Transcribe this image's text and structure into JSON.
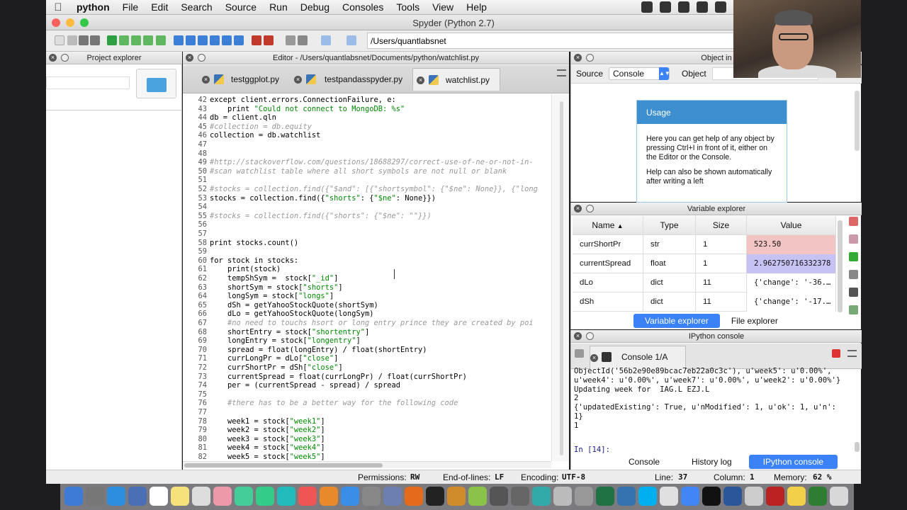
{
  "menubar": {
    "apple_icon": "apple-icon",
    "app": "python",
    "items": [
      "File",
      "Edit",
      "Search",
      "Source",
      "Run",
      "Debug",
      "Consoles",
      "Tools",
      "View",
      "Help"
    ]
  },
  "window": {
    "title": "Spyder (Python 2.7)"
  },
  "toolbar": {
    "path": "/Users/quantlabsnet"
  },
  "project_explorer": {
    "title": "Project explorer"
  },
  "editor": {
    "title": "Editor - /Users/quantlabsnet/Documents/python/watchlist.py",
    "tabs": [
      "testggplot.py",
      "testpandasspyder.py",
      "watchlist.py"
    ],
    "active_tab": 2,
    "lines": [
      {
        "n": "42",
        "t": "except client.errors.ConnectionFailure, e:",
        "c": false
      },
      {
        "n": "43",
        "t": "    print \"Could not connect to MongoDB: %s\"",
        "c": false
      },
      {
        "n": "44",
        "t": "db = client.qln",
        "c": false
      },
      {
        "n": "45",
        "t": "#collection = db.equity",
        "c": true
      },
      {
        "n": "46",
        "t": "collection = db.watchlist",
        "c": false
      },
      {
        "n": "47",
        "t": "",
        "c": false
      },
      {
        "n": "48",
        "t": "",
        "c": false
      },
      {
        "n": "49",
        "t": "#http://stackoverflow.com/questions/18688297/correct-use-of-ne-or-not-in-",
        "c": true
      },
      {
        "n": "50",
        "t": "#scan watchlist table where all short symbols are not null or blank",
        "c": true
      },
      {
        "n": "51",
        "t": "",
        "c": false
      },
      {
        "n": "52",
        "t": "#stocks = collection.find({\"$and\": [{\"shortsymbol\": {\"$ne\": None}}, {\"long",
        "c": true
      },
      {
        "n": "53",
        "t": "stocks = collection.find({\"shorts\": {\"$ne\": None}})",
        "c": false
      },
      {
        "n": "54",
        "t": "",
        "c": false
      },
      {
        "n": "55",
        "t": "#stocks = collection.find({\"shorts\": {\"$ne\": \"\"}})",
        "c": true
      },
      {
        "n": "56",
        "t": "",
        "c": false
      },
      {
        "n": "57",
        "t": "",
        "c": false
      },
      {
        "n": "58",
        "t": "print stocks.count()",
        "c": false
      },
      {
        "n": "59",
        "t": "",
        "c": false
      },
      {
        "n": "60",
        "t": "for stock in stocks:",
        "c": false
      },
      {
        "n": "61",
        "t": "    print(stock)",
        "c": false
      },
      {
        "n": "62",
        "t": "    tempShSym =  stock[\"_id\"]",
        "c": false
      },
      {
        "n": "63",
        "t": "    shortSym = stock[\"shorts\"]",
        "c": false
      },
      {
        "n": "64",
        "t": "    longSym = stock[\"longs\"]",
        "c": false
      },
      {
        "n": "65",
        "t": "    dSh = getYahooStockQuote(shortSym)",
        "c": false
      },
      {
        "n": "66",
        "t": "    dLo = getYahooStockQuote(longSym)",
        "c": false
      },
      {
        "n": "67",
        "t": "    #no need to touchs hsort or long entry prince they are created by poi",
        "c": true
      },
      {
        "n": "68",
        "t": "    shortEntry = stock[\"shortentry\"]",
        "c": false
      },
      {
        "n": "69",
        "t": "    longEntry = stock[\"longentry\"]",
        "c": false
      },
      {
        "n": "70",
        "t": "    spread = float(longEntry) / float(shortEntry)",
        "c": false
      },
      {
        "n": "71",
        "t": "    currLongPr = dLo[\"close\"]",
        "c": false
      },
      {
        "n": "72",
        "t": "    currShortPr = dSh[\"close\"]",
        "c": false
      },
      {
        "n": "73",
        "t": "    currentSpread = float(currLongPr) / float(currShortPr)",
        "c": false
      },
      {
        "n": "74",
        "t": "    per = (currentSpread - spread) / spread",
        "c": false
      },
      {
        "n": "75",
        "t": "",
        "c": false
      },
      {
        "n": "76",
        "t": "    #there has to be a better way for the following code",
        "c": true
      },
      {
        "n": "77",
        "t": "",
        "c": false
      },
      {
        "n": "78",
        "t": "    week1 = stock[\"week1\"]",
        "c": false
      },
      {
        "n": "79",
        "t": "    week2 = stock[\"week2\"]",
        "c": false
      },
      {
        "n": "80",
        "t": "    week3 = stock[\"week3\"]",
        "c": false
      },
      {
        "n": "81",
        "t": "    week4 = stock[\"week4\"]",
        "c": false
      },
      {
        "n": "82",
        "t": "    week5 = stock[\"week5\"]",
        "c": false
      }
    ]
  },
  "help": {
    "title": "Object in",
    "source_label": "Source",
    "source_value": "Console",
    "object_label": "Object",
    "usage_title": "Usage",
    "usage_p1": "Here you can get help of any object by pressing Ctrl+I in front of it, either on the Editor or the Console.",
    "usage_p2": "Help can also be shown automatically after writing a left"
  },
  "variables": {
    "title": "Variable explorer",
    "headers": [
      "Name",
      "Type",
      "Size",
      "Value"
    ],
    "rows": [
      {
        "name": "currShortPr",
        "type": "str",
        "size": "1",
        "value": "523.50",
        "color": "#f2c4c4"
      },
      {
        "name": "currentSpread",
        "type": "float",
        "size": "1",
        "value": "2.962750716332378",
        "color": "#c6c2f3"
      },
      {
        "name": "dLo",
        "type": "dict",
        "size": "11",
        "value": "{'change': '-36.…",
        "color": "#ffffff"
      },
      {
        "name": "dSh",
        "type": "dict",
        "size": "11",
        "value": "{'change': '-17.…",
        "color": "#ffffff"
      }
    ],
    "tabs": [
      "Variable explorer",
      "File explorer"
    ]
  },
  "ipython": {
    "title": "IPython console",
    "tab": "Console 1/A",
    "output": [
      "ObjectId('56b2e90e89bcac7eb22a0c3c'), u'week5': u'0.00%',",
      "u'week4': u'0.00%', u'week7': u'0.00%', u'week2': u'0.00%'}",
      "Updating week for  IAG.L EZJ.L",
      "2",
      "{'updatedExisting': True, u'nModified': 1, u'ok': 1, u'n':",
      "1}",
      "1"
    ],
    "prompt": "In [14]:",
    "tabs": [
      "Console",
      "History log",
      "IPython console"
    ]
  },
  "status": {
    "permissions_label": "Permissions:",
    "permissions": "RW",
    "eol_label": "End-of-lines:",
    "eol": "LF",
    "encoding_label": "Encoding:",
    "encoding": "UTF-8",
    "line_label": "Line:",
    "line": "37",
    "column_label": "Column:",
    "column": "1",
    "memory_label": "Memory:",
    "memory": "62 %"
  },
  "colors": {
    "accent": "#3b82f6",
    "usage_header": "#3d8fd0",
    "string": "#008800",
    "keyword": "#000000",
    "comment": "#999999"
  }
}
